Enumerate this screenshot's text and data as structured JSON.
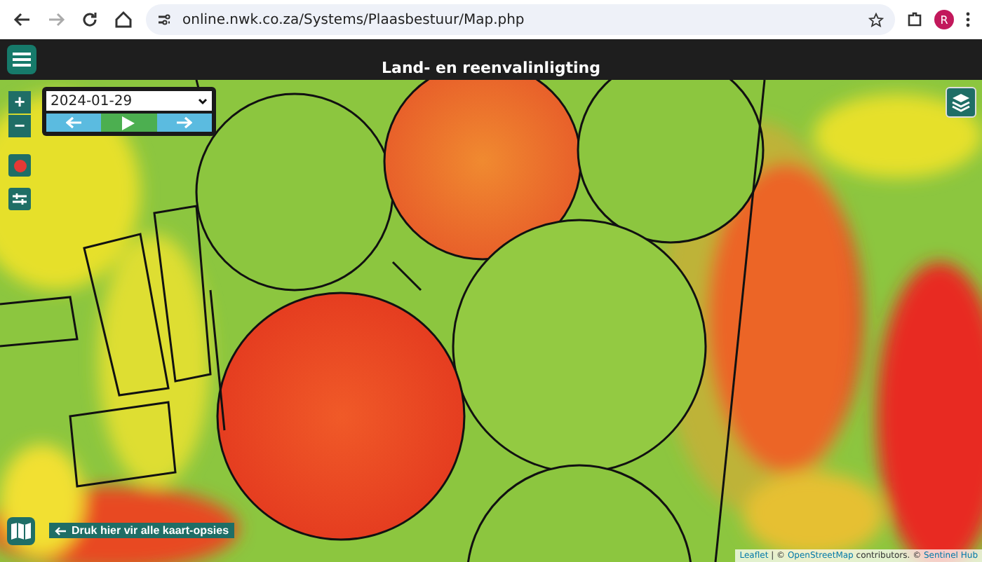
{
  "browser": {
    "url": "online.nwk.co.za/Systems/Plaasbestuur/Map.php",
    "profile_initial": "R"
  },
  "header": {
    "title": "Land- en reenvalinligting"
  },
  "date_select": {
    "value": "2024-01-29"
  },
  "map_hint": {
    "text": "Druk hier vir alle kaart-opsies"
  },
  "zoom_controls": [
    "+",
    "−"
  ],
  "attribution": [
    {
      "kind": "link",
      "text": "Leaflet"
    },
    {
      "kind": "text",
      "text": " | © "
    },
    {
      "kind": "link",
      "text": "OpenStreetMap"
    },
    {
      "kind": "text",
      "text": " contributors. © "
    },
    {
      "kind": "link",
      "text": "Sentinel Hub"
    }
  ]
}
